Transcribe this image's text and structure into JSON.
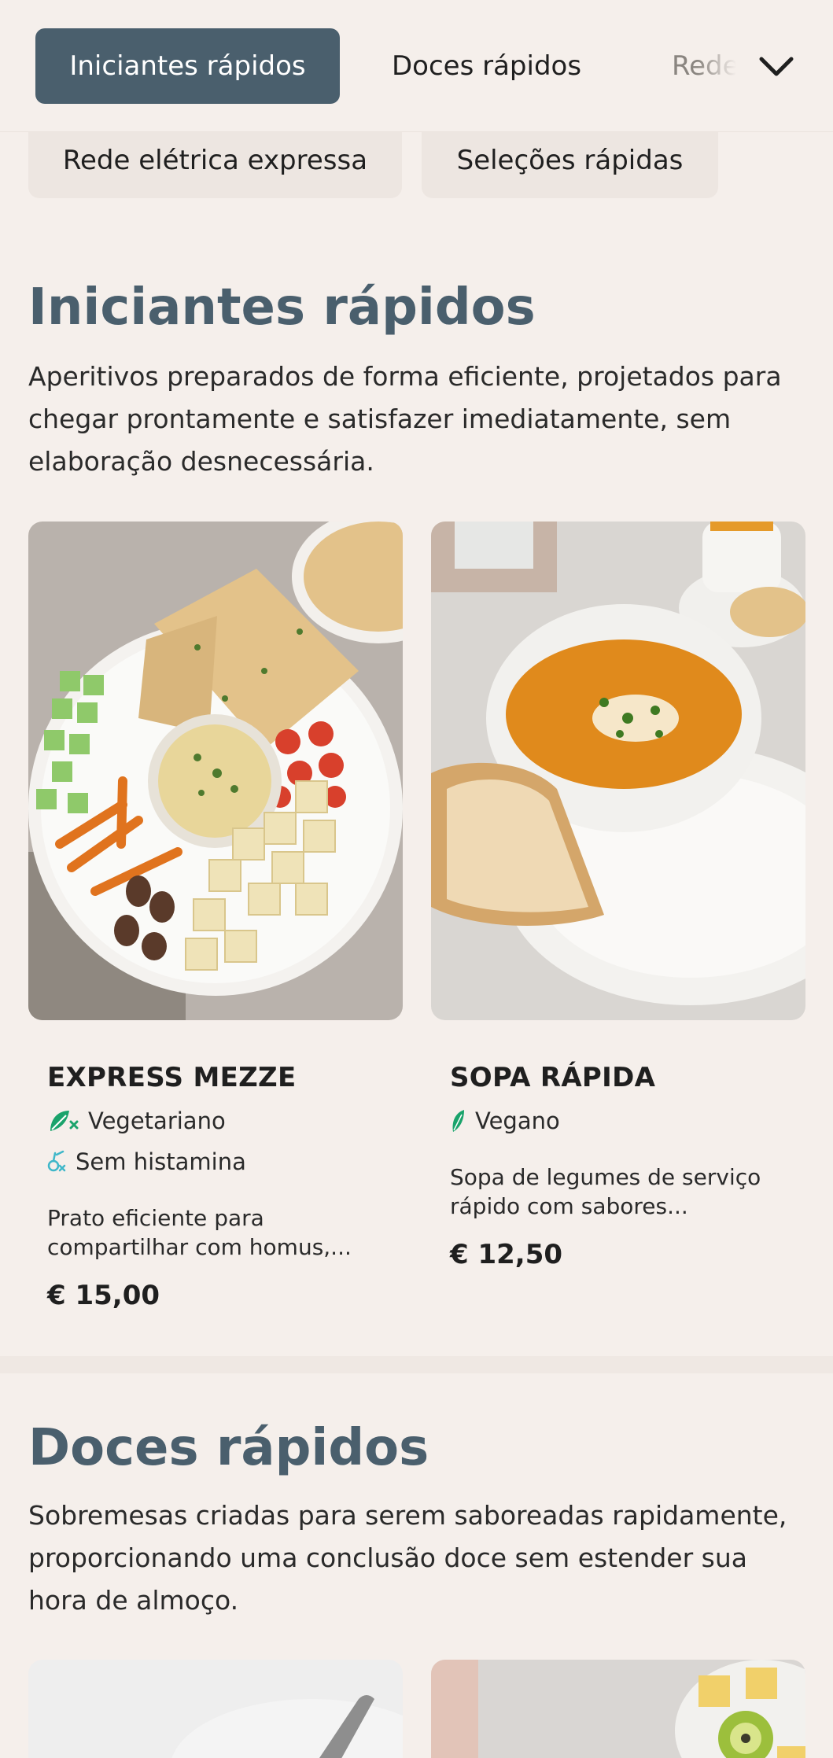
{
  "nav": {
    "tabs": [
      {
        "label": "Iniciantes rápidos",
        "active": true
      },
      {
        "label": "Doces rápidos",
        "active": false
      },
      {
        "label": "Rede elétrica expressa",
        "active": false
      }
    ],
    "overflow_chips": [
      "Rede elétrica expressa",
      "Seleções rápidas"
    ],
    "expand_icon": "chevron-down-icon"
  },
  "sections": [
    {
      "title": "Iniciantes rápidos",
      "description": "Aperitivos preparados de forma eficiente, projetados para chegar prontamente e satisfazer imediatamente, sem elaboração desnecessária.",
      "items": [
        {
          "name": "EXPRESS MEZZE",
          "tags": [
            {
              "icon": "vegetarian-icon",
              "label": "Vegetariano"
            },
            {
              "icon": "histamine-free-icon",
              "label": "Sem histamina"
            }
          ],
          "description": "Prato eficiente para compartilhar com homus,...",
          "price": "€ 15,00"
        },
        {
          "name": "SOPA RÁPIDA",
          "tags": [
            {
              "icon": "vegan-leaf-icon",
              "label": "Vegano"
            }
          ],
          "description": "Sopa de legumes de serviço rápido com sabores...",
          "price": "€ 12,50"
        }
      ]
    },
    {
      "title": "Doces rápidos",
      "description": "Sobremesas criadas para serem saboreadas rapidamente, proporcionando uma conclusão doce sem estender sua hora de almoço."
    }
  ],
  "colors": {
    "background": "#f5efeb",
    "accent": "#4a5f6d",
    "chip": "#ede6e1",
    "tag_green": "#1aa36b",
    "tag_teal": "#3fb7c9"
  }
}
